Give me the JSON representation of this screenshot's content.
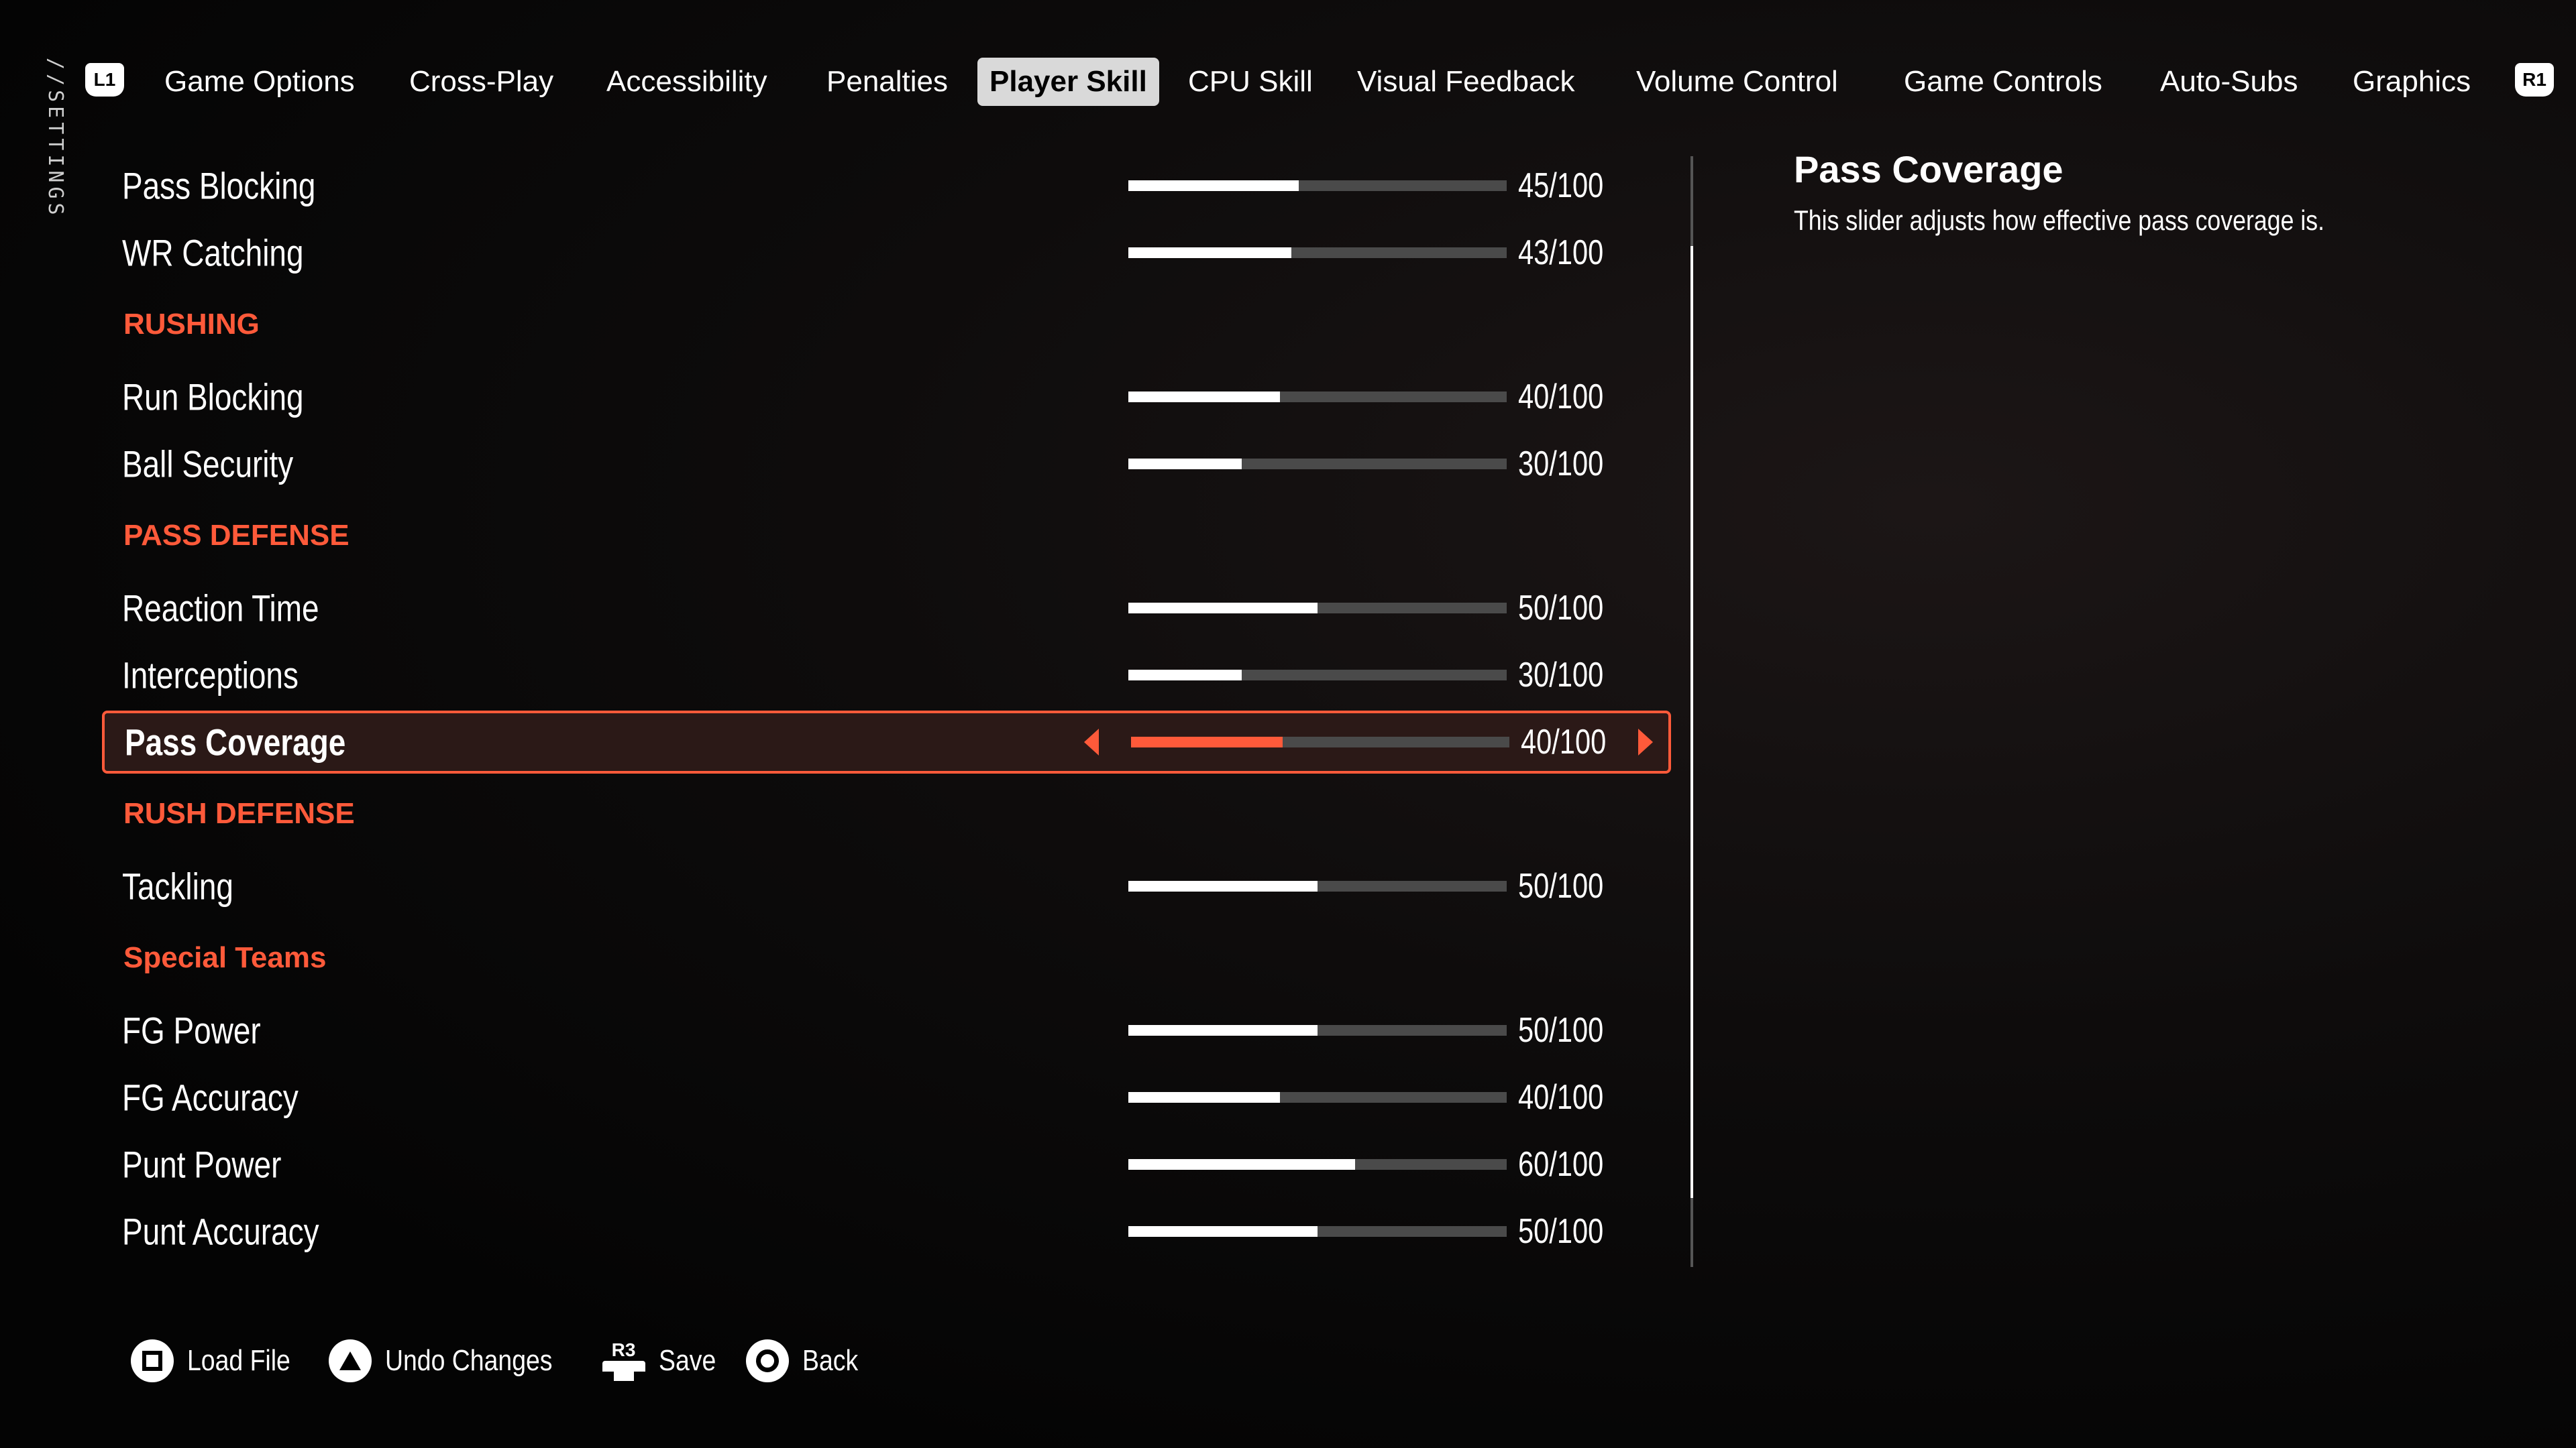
{
  "sidebar_label": "//SETTINGS",
  "nav": {
    "left_bumper": "L1",
    "right_bumper": "R1",
    "tabs": [
      "Game Options",
      "Cross-Play",
      "Accessibility",
      "Penalties",
      "Player Skill",
      "CPU Skill",
      "Visual Feedback",
      "Volume Control",
      "Game Controls",
      "Auto-Subs",
      "Graphics"
    ],
    "active_tab": "Player Skill"
  },
  "rows": [
    {
      "type": "slider",
      "label": "Pass Blocking",
      "value": 45,
      "display": "45/100"
    },
    {
      "type": "slider",
      "label": "WR Catching",
      "value": 43,
      "display": "43/100"
    },
    {
      "type": "header",
      "label": "RUSHING"
    },
    {
      "type": "slider",
      "label": "Run Blocking",
      "value": 40,
      "display": "40/100"
    },
    {
      "type": "slider",
      "label": "Ball Security",
      "value": 30,
      "display": "30/100"
    },
    {
      "type": "header",
      "label": "PASS DEFENSE"
    },
    {
      "type": "slider",
      "label": "Reaction Time",
      "value": 50,
      "display": "50/100"
    },
    {
      "type": "slider",
      "label": "Interceptions",
      "value": 30,
      "display": "30/100"
    },
    {
      "type": "slider",
      "label": "Pass Coverage",
      "value": 40,
      "display": "40/100",
      "selected": true
    },
    {
      "type": "header",
      "label": "RUSH DEFENSE"
    },
    {
      "type": "slider",
      "label": "Tackling",
      "value": 50,
      "display": "50/100"
    },
    {
      "type": "header",
      "label": "Special Teams"
    },
    {
      "type": "slider",
      "label": "FG Power",
      "value": 50,
      "display": "50/100"
    },
    {
      "type": "slider",
      "label": "FG Accuracy",
      "value": 40,
      "display": "40/100"
    },
    {
      "type": "slider",
      "label": "Punt Power",
      "value": 60,
      "display": "60/100"
    },
    {
      "type": "slider",
      "label": "Punt Accuracy",
      "value": 50,
      "display": "50/100"
    }
  ],
  "detail": {
    "title": "Pass Coverage",
    "description": "This slider adjusts how effective pass coverage is."
  },
  "footer": [
    {
      "icon": "square-button-icon",
      "label": "Load File"
    },
    {
      "icon": "triangle-button-icon",
      "label": "Undo Changes"
    },
    {
      "icon": "r3-button-icon",
      "label": "Save",
      "button_text": "R3"
    },
    {
      "icon": "circle-button-icon",
      "label": "Back"
    }
  ],
  "colors": {
    "accent": "#ff5a3a",
    "selected_bg": "#2b1917",
    "track": "#4a4a4a"
  }
}
